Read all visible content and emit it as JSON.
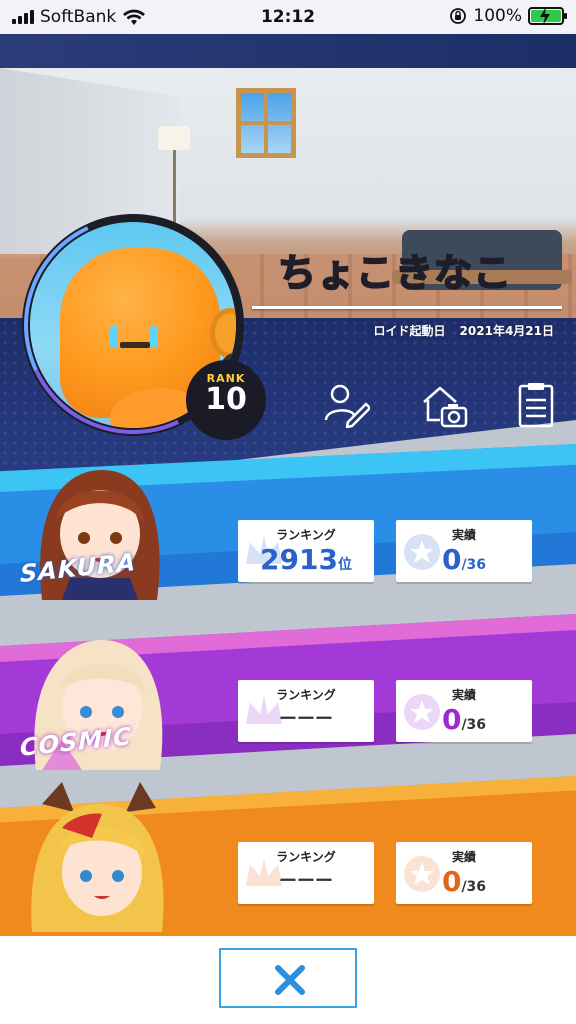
{
  "status_bar": {
    "carrier": "SoftBank",
    "time": "12:12",
    "battery": "100%"
  },
  "profile": {
    "name": "ちょこきなこ",
    "boot_label": "ロイド起動日",
    "boot_date": "2021年4月21日",
    "rank_label": "RANK",
    "rank_value": "10"
  },
  "toolbar": {
    "icons": [
      "edit-profile-icon",
      "room-photo-icon",
      "clipboard-icon"
    ]
  },
  "cards": [
    {
      "name": "SAKURA",
      "ranking_label": "ランキング",
      "ranking_value": "2913",
      "ranking_suffix": "位",
      "achievement_label": "実績",
      "achievement_value": "0",
      "achievement_total": "/36",
      "colors": {
        "primary": "#2a8ee6",
        "secondary": "#3cc4f5",
        "value": "#2a62c9"
      }
    },
    {
      "name": "COSMIC",
      "ranking_label": "ランキング",
      "ranking_value": "ーーー",
      "ranking_suffix": "",
      "achievement_label": "実績",
      "achievement_value": "0",
      "achievement_total": "/36",
      "colors": {
        "primary": "#a33ad8",
        "secondary": "#e06ad6",
        "value": "#9d2ad1"
      }
    },
    {
      "name": "",
      "ranking_label": "ランキング",
      "ranking_value": "ーーー",
      "ranking_suffix": "",
      "achievement_label": "実績",
      "achievement_value": "0",
      "achievement_total": "/36",
      "colors": {
        "primary": "#f08a1e",
        "secondary": "#f7b03a",
        "value": "#e2661a"
      }
    }
  ],
  "close_button": {
    "icon": "close-icon"
  }
}
